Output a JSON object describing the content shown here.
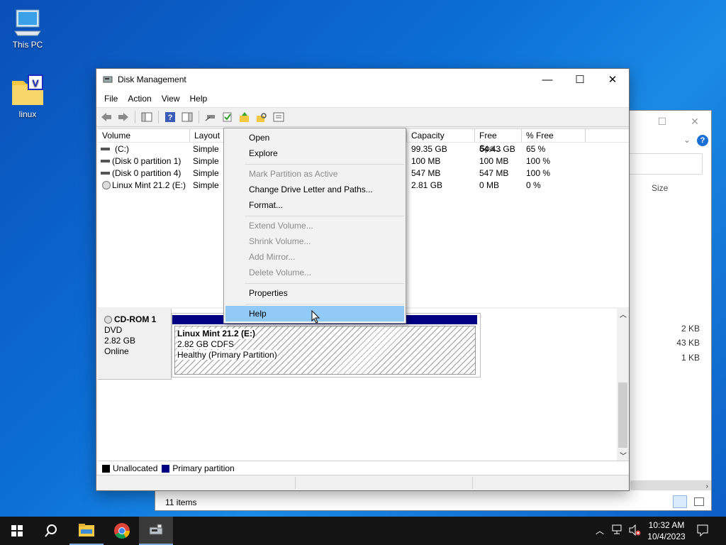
{
  "desktop": {
    "icons": [
      {
        "label": "This PC",
        "icon": "computer-icon"
      },
      {
        "label": "linux",
        "icon": "folder-icon"
      }
    ]
  },
  "background_window": {
    "column_size": "Size",
    "sizes": [
      "2 KB",
      "43 KB",
      "1 KB"
    ],
    "status": "11 items"
  },
  "disk_management": {
    "title": "Disk Management",
    "menu": [
      "File",
      "Action",
      "View",
      "Help"
    ],
    "columns": [
      "Volume",
      "Layout",
      "Capacity",
      "Free Spa...",
      "% Free"
    ],
    "volumes": [
      {
        "name": "(C:)",
        "layout": "Simple",
        "capacity": "99.35 GB",
        "free": "64.43 GB",
        "pct": "65 %"
      },
      {
        "name": "(Disk 0 partition 1)",
        "layout": "Simple",
        "capacity": "100 MB",
        "free": "100 MB",
        "pct": "100 %"
      },
      {
        "name": "(Disk 0 partition 4)",
        "layout": "Simple",
        "capacity": "547 MB",
        "free": "547 MB",
        "pct": "100 %"
      },
      {
        "name": "Linux Mint 21.2 (E:)",
        "layout": "Simple",
        "capacity": "2.81 GB",
        "free": "0 MB",
        "pct": "0 %"
      }
    ],
    "disk": {
      "name": "CD-ROM 1",
      "type": "DVD",
      "size": "2.82 GB",
      "state": "Online"
    },
    "partition": {
      "name": "Linux Mint 21.2  (E:)",
      "fs": "2.82 GB CDFS",
      "status": "Healthy (Primary Partition)"
    },
    "legend": {
      "unallocated": "Unallocated",
      "primary": "Primary partition",
      "unallocated_color": "#000000",
      "primary_color": "#000080"
    }
  },
  "context_menu": {
    "items": [
      {
        "label": "Open",
        "enabled": true
      },
      {
        "label": "Explore",
        "enabled": true
      },
      {
        "label": "Mark Partition as Active",
        "enabled": false
      },
      {
        "label": "Change Drive Letter and Paths...",
        "enabled": true
      },
      {
        "label": "Format...",
        "enabled": true
      },
      {
        "label": "Extend Volume...",
        "enabled": false
      },
      {
        "label": "Shrink Volume...",
        "enabled": false
      },
      {
        "label": "Add Mirror...",
        "enabled": false
      },
      {
        "label": "Delete Volume...",
        "enabled": false
      },
      {
        "label": "Properties",
        "enabled": true
      },
      {
        "label": "Help",
        "enabled": true,
        "highlighted": true
      }
    ]
  },
  "taskbar": {
    "time": "10:32 AM",
    "date": "10/4/2023"
  }
}
